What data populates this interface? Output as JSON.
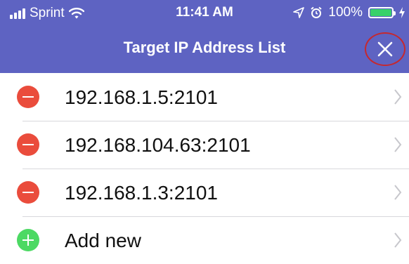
{
  "status_bar": {
    "carrier": "Sprint",
    "time": "11:41 AM",
    "battery": "100%",
    "battery_level": 1.0,
    "icons": [
      "signal-bars-icon",
      "wifi-icon",
      "location-arrow-icon",
      "alarm-icon",
      "battery-icon",
      "charging-bolt-icon"
    ]
  },
  "nav": {
    "title": "Target IP Address List",
    "close_icon": "close-icon"
  },
  "list": {
    "items": [
      {
        "label": "192.168.1.5:2101",
        "action": "delete"
      },
      {
        "label": "192.168.104.63:2101",
        "action": "delete"
      },
      {
        "label": "192.168.1.3:2101",
        "action": "delete"
      }
    ],
    "add_new_label": "Add new"
  },
  "colors": {
    "header": "#5e63c2",
    "delete": "#ea4c3c",
    "add": "#4cd963",
    "annotation_circle": "#c5282f"
  }
}
